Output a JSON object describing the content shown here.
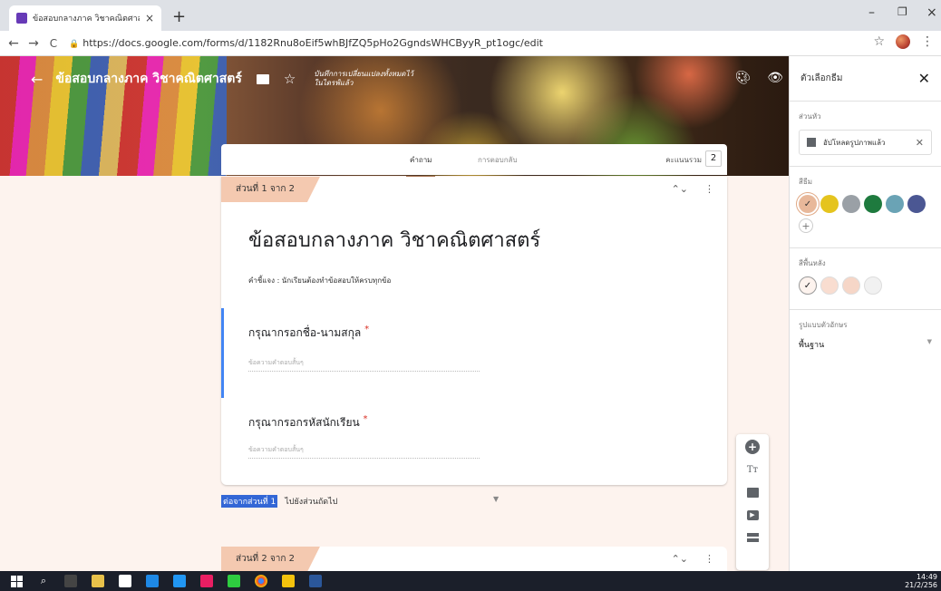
{
  "browser": {
    "tab_title": "ข้อสอบกลางภาค วิชาคณิตศาสตร์ - G",
    "tab_close": "×",
    "new_tab": "+",
    "back": "←",
    "forward": "→",
    "reload": "C",
    "url": "https://docs.google.com/forms/d/1182Rnu8oEif5whBJfZQ5pHo2GgndsWHCByyR_pt1ogc/edit",
    "minimize": "–",
    "restore": "❐",
    "close": "×",
    "bookmark_star": "☆",
    "menu": "⋮"
  },
  "header": {
    "back_arrow": "←",
    "form_name": "ข้อสอบกลางภาค วิชาคณิตศาสตร์",
    "star": "☆",
    "saved_status_line1": "บันทึกการเปลี่ยนแปลงทั้งหมดไว้",
    "saved_status_line2": "ในไดรฟ์แล้ว",
    "palette_icon": "palette-icon",
    "preview_icon": "eye-icon",
    "settings_icon": "gear-icon"
  },
  "tabs": {
    "questions": "คำถาม",
    "responses": "การตอบกลับ",
    "total_points_label": "คะแนนรวม",
    "total_points": "2"
  },
  "section1": {
    "tag": "ส่วนที่ 1 จาก 2",
    "collapse_icon": "⌃⌄",
    "more_icon": "⋮",
    "title": "ข้อสอบกลางภาค วิชาคณิตศาสตร์",
    "description": "คำชี้แจง : นักเรียนต้องทำข้อสอบให้ครบทุกข้อ",
    "questions": [
      {
        "title": "กรุณากรอกชื่อ-นามสกุล",
        "required": "*",
        "placeholder": "ข้อความคำตอบสั้นๆ"
      },
      {
        "title": "กรุณากรอกรหัสนักเรียน",
        "required": "*",
        "placeholder": "ข้อความคำตอบสั้นๆ"
      }
    ]
  },
  "after_section": {
    "label": "ต่อจากส่วนที่ 1",
    "action": "ไปยังส่วนถัดไป",
    "caret": "▼"
  },
  "section2": {
    "tag": "ส่วนที่ 2 จาก 2",
    "collapse_icon": "⌃⌄",
    "more_icon": "⋮"
  },
  "floating_toolbar": {
    "add_question": "+",
    "add_title": "Tт",
    "add_image": "image-icon",
    "add_video": "▶",
    "add_section": "section-icon"
  },
  "theme_panel": {
    "title": "ตัวเลือกธีม",
    "close": "✕",
    "header_label": "ส่วนหัว",
    "header_chip": "อัปโหลดรูปภาพแล้ว",
    "header_chip_remove": "✕",
    "theme_color_label": "สีธีม",
    "theme_colors": [
      "#e8b89a",
      "#e5c41e",
      "#9aa0a6",
      "#1e7a3e",
      "#6aa3b5",
      "#4b5793"
    ],
    "selected_check": "✓",
    "add_color": "+",
    "background_label": "สีพื้นหลัง",
    "background_colors": [
      "#fdf3ee",
      "#f9ddd0",
      "#f6d6c7",
      "#f1f1f1"
    ],
    "font_label": "รูปแบบตัวอักษร",
    "font_value": "พื้นฐาน",
    "font_caret": "▼"
  },
  "taskbar": {
    "time": "14:49",
    "date": "21/2/256"
  }
}
